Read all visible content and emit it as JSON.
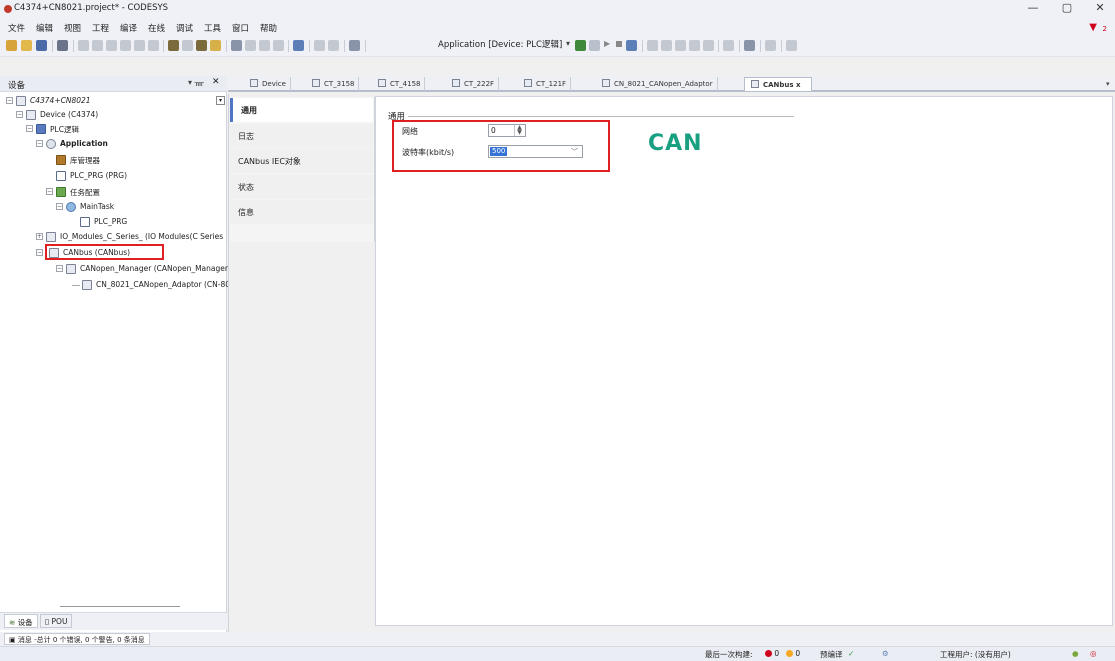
{
  "window": {
    "title": "C4374+CN8021.project* - CODESYS",
    "minimize": "—",
    "maximize": "▢",
    "close": "✕"
  },
  "menu": [
    "文件",
    "编辑",
    "视图",
    "工程",
    "编译",
    "在线",
    "调试",
    "工具",
    "窗口",
    "帮助"
  ],
  "alerts": {
    "count": "2"
  },
  "toolbar": {
    "active_application": "Application [Device: PLC逻辑]"
  },
  "devices_panel": {
    "title": "设备",
    "pin": "▾ ᚄ",
    "close": "✕",
    "tree": [
      {
        "label": "C4374+CN8021",
        "italic": true
      },
      {
        "label": "Device (C4374)"
      },
      {
        "label": "PLC逻辑"
      },
      {
        "label": "Application",
        "bold": true
      },
      {
        "label": "库管理器"
      },
      {
        "label": "PLC_PRG (PRG)"
      },
      {
        "label": "任务配置"
      },
      {
        "label": "MainTask"
      },
      {
        "label": "PLC_PRG"
      },
      {
        "label": "IO_Modules_C_Series_ (IO Modules(C Series"
      },
      {
        "label": "CANbus (CANbus)"
      },
      {
        "label": "CANopen_Manager (CANopen_Manager)"
      },
      {
        "label": "CN_8021_CANopen_Adaptor (CN-80"
      }
    ],
    "bottom_tabs": [
      "设备",
      "POU"
    ]
  },
  "editor_tabs": [
    "Device",
    "CT_3158",
    "CT_4158",
    "CT_222F",
    "CT_121F",
    "CN_8021_CANopen_Adaptor",
    "CANbus"
  ],
  "active_editor_tab": "CANbus",
  "editor_tab_close": "x",
  "side_tabs": [
    "通用",
    "日志",
    "CANbus IEC对象",
    "状态",
    "信息"
  ],
  "general": {
    "group_title": "通用",
    "network_label": "网络",
    "network_value": "0",
    "baud_label": "波特率(kbit/s)",
    "baud_value": "500",
    "logo_text": "CAN"
  },
  "messages": {
    "label": "消息 -总计 0 个错误, 0 个警告, 0 条消息"
  },
  "status": {
    "last_build_label": "最后一次构建:",
    "errors": "0",
    "warnings": "0",
    "precompile_label": "预编译",
    "precompile_ok": "✓",
    "project_user": "工程用户: (没有用户)"
  },
  "colors": {
    "accent": "#4f76c3",
    "highlight": "#e02020",
    "can_logo": "#18a081",
    "selection": "#3574d6"
  }
}
